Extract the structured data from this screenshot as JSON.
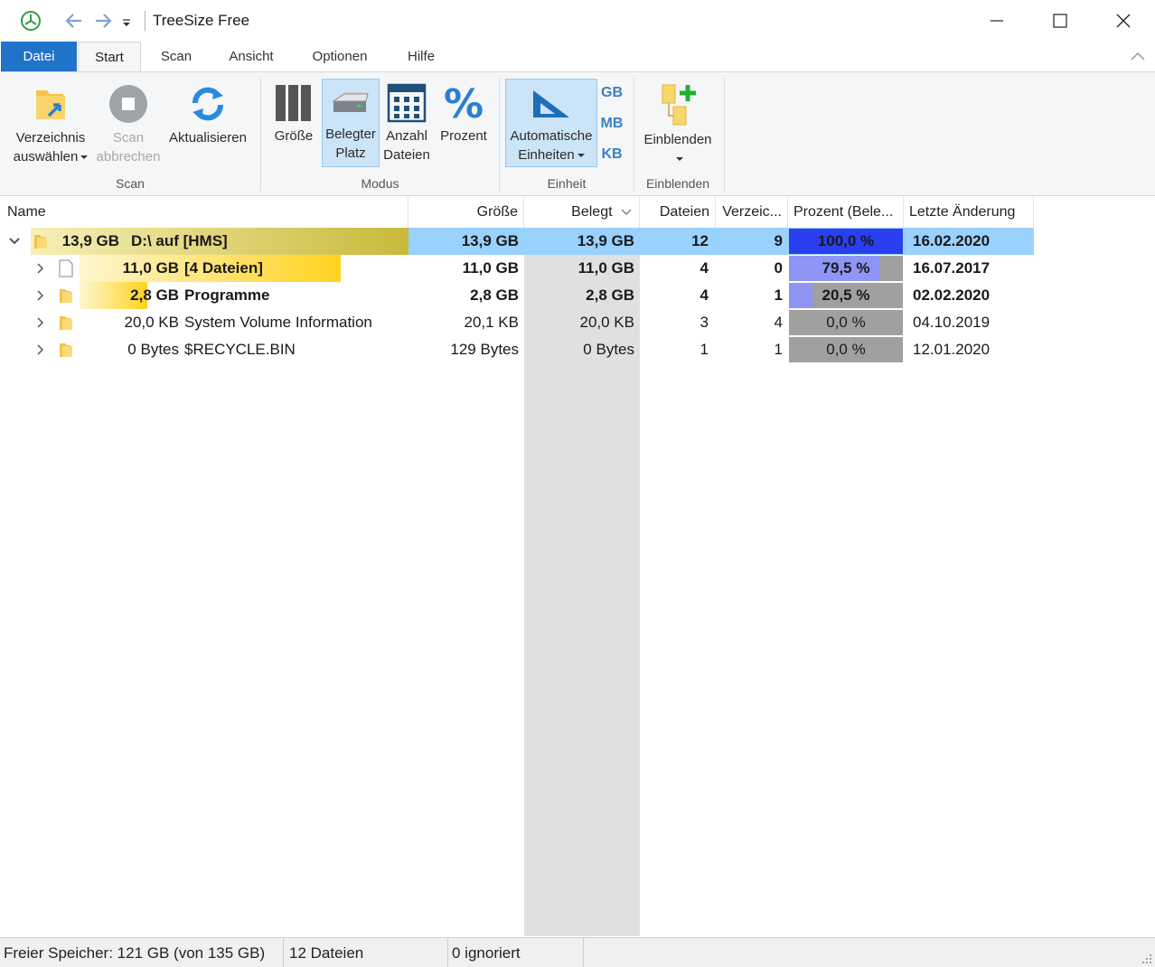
{
  "titlebar": {
    "title": "TreeSize Free"
  },
  "tabs": [
    {
      "label": "Datei"
    },
    {
      "label": "Start"
    },
    {
      "label": "Scan"
    },
    {
      "label": "Ansicht"
    },
    {
      "label": "Optionen"
    },
    {
      "label": "Hilfe"
    }
  ],
  "ribbon": {
    "scan": {
      "group_label": "Scan",
      "select_dir_line1": "Verzeichnis",
      "select_dir_line2": "auswählen",
      "abort_line1": "Scan",
      "abort_line2": "abbrechen",
      "refresh": "Aktualisieren"
    },
    "modus": {
      "group_label": "Modus",
      "size": "Größe",
      "used_line1": "Belegter",
      "used_line2": "Platz",
      "count_line1": "Anzahl",
      "count_line2": "Dateien",
      "percent": "Prozent"
    },
    "einheit": {
      "group_label": "Einheit",
      "auto_line1": "Automatische",
      "auto_line2": "Einheiten",
      "gb": "GB",
      "mb": "MB",
      "kb": "KB"
    },
    "einblenden": {
      "group_label": "Einblenden",
      "show": "Einblenden"
    }
  },
  "table": {
    "columns": {
      "name": "Name",
      "size": "Größe",
      "used": "Belegt",
      "files": "Dateien",
      "folders": "Verzeic...",
      "percent": "Prozent (Bele...",
      "modified": "Letzte Änderung"
    },
    "rows": [
      {
        "name_size": "13,9 GB",
        "name": "D:\\  auf  [HMS]",
        "size": "13,9 GB",
        "used": "13,9 GB",
        "files": "12",
        "folders": "9",
        "percent": "100,0 %",
        "percent_value": 1.0,
        "name_bar_fraction": 1.0,
        "modified": "16.02.2020",
        "bold": true,
        "selected": true,
        "expanded": true,
        "icon": "folder-icon"
      },
      {
        "name_size": "11,0 GB",
        "name": "[4 Dateien]",
        "size": "11,0 GB",
        "used": "11,0 GB",
        "files": "4",
        "folders": "0",
        "percent": "79,5 %",
        "percent_value": 0.795,
        "name_bar_fraction": 0.795,
        "modified": "16.07.2017",
        "bold": true,
        "selected": false,
        "expanded": false,
        "icon": "file-icon"
      },
      {
        "name_size": "2,8 GB",
        "name": "Programme",
        "size": "2,8 GB",
        "used": "2,8 GB",
        "files": "4",
        "folders": "1",
        "percent": "20,5 %",
        "percent_value": 0.205,
        "name_bar_fraction": 0.205,
        "modified": "02.02.2020",
        "bold": true,
        "selected": false,
        "expanded": false,
        "icon": "folder-icon"
      },
      {
        "name_size": "20,0 KB",
        "name": "System Volume Information",
        "size": "20,1 KB",
        "used": "20,0 KB",
        "files": "3",
        "folders": "4",
        "percent": "0,0 %",
        "percent_value": 0.0,
        "name_bar_fraction": 0.0,
        "modified": "04.10.2019",
        "bold": false,
        "selected": false,
        "expanded": false,
        "icon": "folder-icon"
      },
      {
        "name_size": "0 Bytes",
        "name": "$RECYCLE.BIN",
        "size": "129 Bytes",
        "used": "0 Bytes",
        "files": "1",
        "folders": "1",
        "percent": "0,0 %",
        "percent_value": 0.0,
        "name_bar_fraction": 0.0,
        "modified": "12.01.2020",
        "bold": false,
        "selected": false,
        "expanded": false,
        "icon": "folder-icon"
      }
    ]
  },
  "status": {
    "free": "Freier Speicher: 121 GB  (von 135 GB)",
    "files": "12 Dateien",
    "ignored": "0 ignoriert"
  },
  "colors": {
    "accent": "#1f73c9",
    "selection": "#99d1ff",
    "ribbon_pressed": "#cce4f7",
    "percent_fill_root": "#2a3ff0",
    "percent_fill": "#8f95f5",
    "name_bar_root": "#c9b93a",
    "name_bar": "#ffd21f"
  }
}
